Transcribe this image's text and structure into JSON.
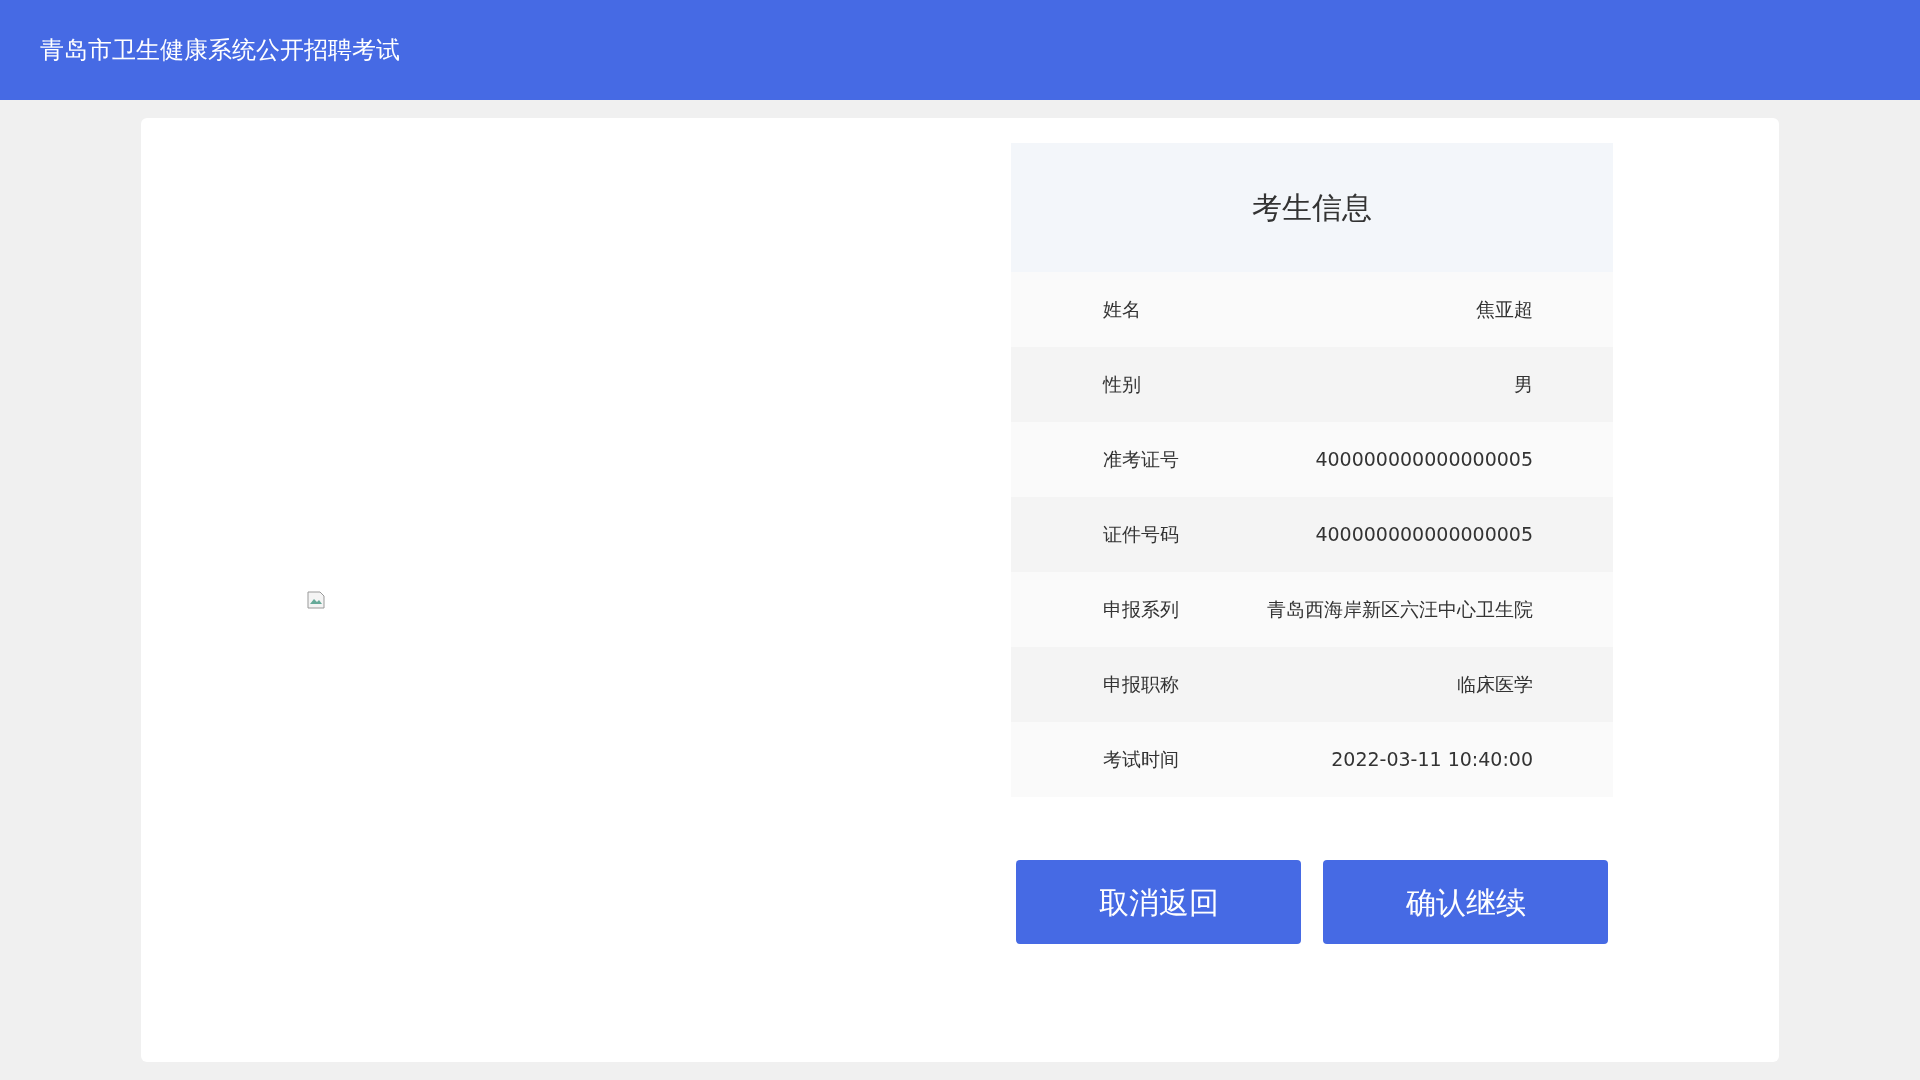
{
  "header": {
    "title": "青岛市卫生健康系统公开招聘考试"
  },
  "info_panel": {
    "title": "考生信息",
    "rows": [
      {
        "label": "姓名",
        "value": "焦亚超"
      },
      {
        "label": "性别",
        "value": "男"
      },
      {
        "label": "准考证号",
        "value": "400000000000000005"
      },
      {
        "label": "证件号码",
        "value": "400000000000000005"
      },
      {
        "label": "申报系列",
        "value": "青岛西海岸新区六汪中心卫生院"
      },
      {
        "label": "申报职称",
        "value": "临床医学"
      },
      {
        "label": "考试时间",
        "value": "2022-03-11 10:40:00"
      }
    ]
  },
  "buttons": [
    "取消返回",
    "确认继续"
  ]
}
